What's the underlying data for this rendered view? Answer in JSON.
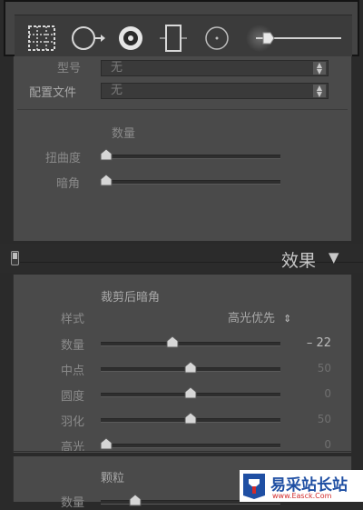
{
  "toolbar": {
    "tools": [
      "grid-overlay-icon",
      "spot-removal-icon",
      "red-eye-icon",
      "graduated-filter-icon",
      "radial-filter-icon",
      "adjustment-brush-icon"
    ],
    "size_slider_level": 0.06
  },
  "lens": {
    "model_label": "型号",
    "model_value": "无",
    "profile_label": "配置文件",
    "profile_value": "无",
    "amount_title": "数量",
    "distortion_label": "扭曲度",
    "distortion_level": 0.0,
    "vignette_label": "暗角",
    "vignette_level": 0.0
  },
  "effects": {
    "header_title": "效果",
    "header_arrow": "▼",
    "post_crop_vignette_title": "裁剪后暗角",
    "style_label": "样式",
    "style_value": "高光优先",
    "style_arrow": "⇕",
    "sliders": [
      {
        "label": "数量",
        "value": "– 22",
        "level": 0.39
      },
      {
        "label": "中点",
        "value": "50",
        "level": 0.5
      },
      {
        "label": "圆度",
        "value": "0",
        "level": 0.5
      },
      {
        "label": "羽化",
        "value": "50",
        "level": 0.5
      },
      {
        "label": "高光",
        "value": "0",
        "level": 0.0
      }
    ],
    "grain_title": "颗粒",
    "grain_amount_label": "数量"
  },
  "watermark": {
    "title": "易采站长站",
    "url": "www.Easck.Com"
  },
  "colors": {
    "panel": "#4a4a4a",
    "toolbar": "#444444",
    "watermark_blue": "#1f4fa3",
    "watermark_red": "#d22b2b"
  }
}
